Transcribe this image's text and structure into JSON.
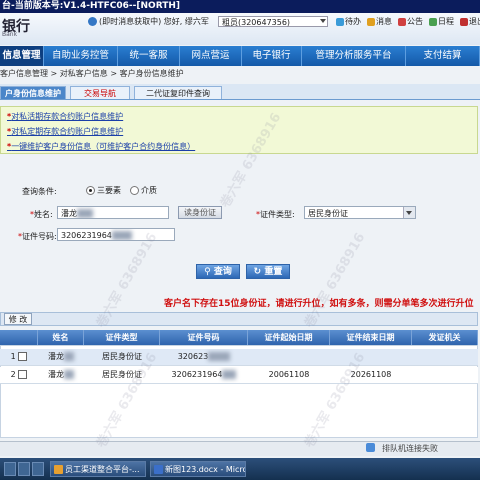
{
  "window": {
    "title": "台-当前版本号:V1.4-HTFC06--[NORTH]"
  },
  "header": {
    "logo_text": "银行",
    "logo_sub": "Bank",
    "msg_status": "(即时消息获取中)",
    "greeting": "您好, 缪六军",
    "org_select": "粗员(320647356)",
    "quick_links": [
      "待办",
      "消息",
      "公告",
      "日程",
      "退出"
    ]
  },
  "mainnav": {
    "items": [
      "信息管理",
      "自助业务控管",
      "统一客服",
      "网点营运",
      "电子银行",
      "管理分析服务平台",
      "支付结算"
    ],
    "active_index": 0
  },
  "breadcrumb": {
    "items": [
      "客户信息管理",
      "对私客户信息",
      "客户身份信息维护"
    ],
    "separator": ">"
  },
  "tabs": {
    "items": [
      "户身份信息维护",
      "交易导航",
      "二代证复印件查询"
    ]
  },
  "links": [
    "对私活期存款合约账户信息维护",
    "对私定期存款合约账户信息维护",
    "一键维护客户身份信息（可维护客户合约身份信息）"
  ],
  "link_marker": "*",
  "form": {
    "query_condition_label": "查询条件:",
    "radio_options": [
      "三要素",
      "介质"
    ],
    "radio_selected": 0,
    "name_label": "姓名:",
    "name_value": "潘龙",
    "read_id_button": "读身份证",
    "id_type_label": "证件类型:",
    "id_type_value": "居民身份证",
    "id_number_label": "证件号码:",
    "id_number_value": "3206231964",
    "required_mark": "*",
    "query_button": "查询",
    "reset_button": "重置"
  },
  "warning": "客户名下存在15位身份证，请进行升位，如有多条，则需分单笔多次进行升位",
  "table": {
    "edit_button": "修 改",
    "columns": [
      "",
      "姓名",
      "证件类型",
      "证件号码",
      "证件起始日期",
      "证件结束日期",
      "发证机关"
    ],
    "rows": [
      {
        "index": "1",
        "name": "潘龙",
        "id_type": "居民身份证",
        "id_number": "320623",
        "start_date": "",
        "end_date": "",
        "authority": ""
      },
      {
        "index": "2",
        "name": "潘龙",
        "id_type": "居民身份证",
        "id_number": "3206231964",
        "start_date": "20061108",
        "end_date": "20261108",
        "authority": ""
      }
    ]
  },
  "statusbar": {
    "text": "排队机连接失败"
  },
  "taskbar": {
    "items": [
      "员工渠道整合平台-...",
      "新图123.docx - Micro..."
    ]
  },
  "watermark": "卷六军 6368916",
  "colors": {
    "nav_blue": "#1459a8",
    "active_tab": "#4b86c9",
    "warning_red": "#d01010",
    "link_blue": "#1a3fa8",
    "link_panel": "#f2f9d6"
  }
}
